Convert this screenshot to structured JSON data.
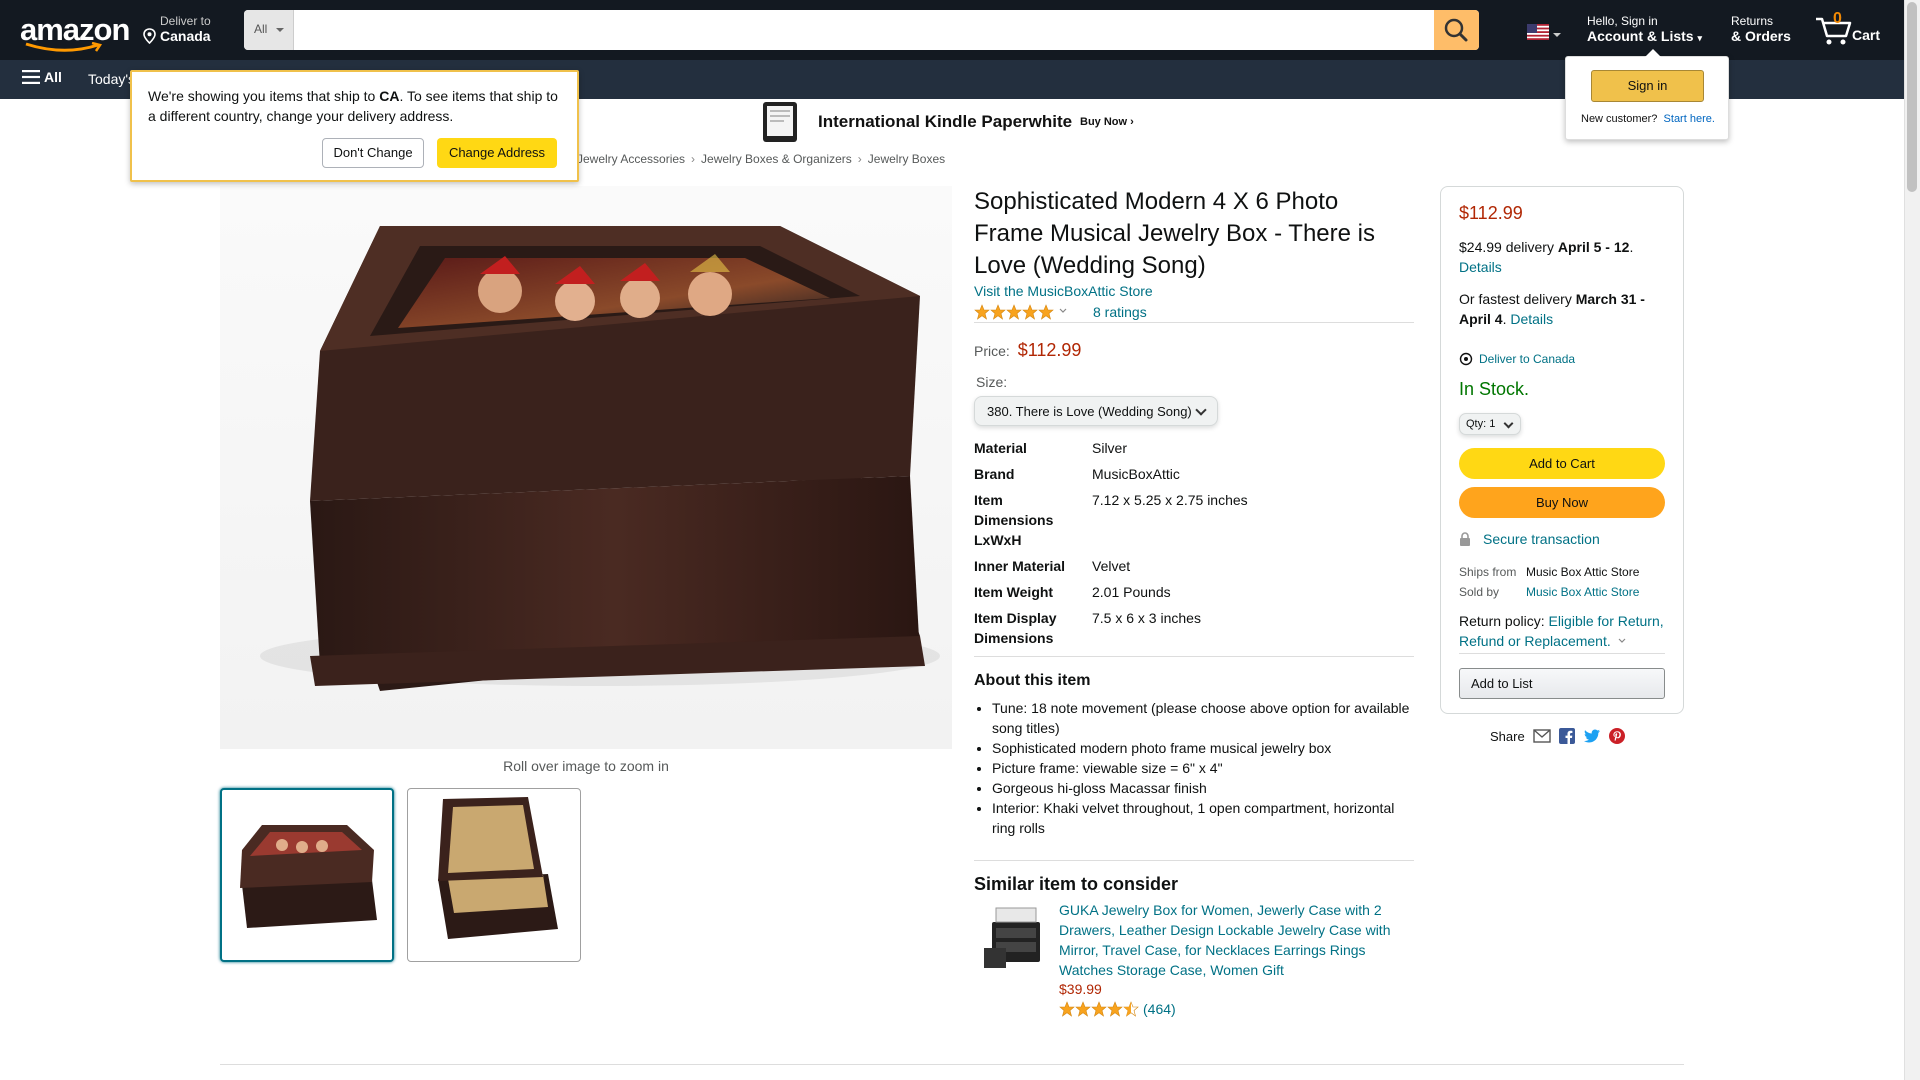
{
  "header": {
    "logo": "amazon",
    "deliver_line1": "Deliver to",
    "deliver_line2": "Canada",
    "search_category": "All",
    "search_placeholder": "",
    "account_line1": "Hello, Sign in",
    "account_line2": "Account & Lists",
    "returns_line1": "Returns",
    "returns_line2": "& Orders",
    "cart_count": "0",
    "cart_label": "Cart"
  },
  "nav": {
    "all_label": "All",
    "todays": "Today's"
  },
  "banner": {
    "title": "International Kindle Paperwhite",
    "cta": "Buy Now ›"
  },
  "breadcrumb": [
    "Jewelry Accessories",
    "Jewelry Boxes & Organizers",
    "Jewelry Boxes"
  ],
  "breadcrumb_sep": "›",
  "popover": {
    "text_a": "We're showing you items that ship to ",
    "text_country": "CA",
    "text_b": ". To see items that ship to a different country, change your delivery address.",
    "dont_change": "Don't Change",
    "change_address": "Change Address"
  },
  "flyout": {
    "sign_in": "Sign in",
    "new_customer": "New customer?",
    "start_here": "Start here."
  },
  "gallery": {
    "zoom_note": "Roll over image to zoom in"
  },
  "product": {
    "title": "Sophisticated Modern 4 X 6 Photo Frame Musical Jewelry Box - There is Love (Wedding Song)",
    "store_link": "Visit the MusicBoxAttic Store",
    "rating_stars": 5,
    "ratings_text": "8 ratings",
    "price_label": "Price:",
    "price": "$112.99",
    "size_label": "Size:",
    "size_value": "380. There is Love (Wedding Song)",
    "specs": [
      {
        "k": "Material",
        "v": "Silver"
      },
      {
        "k": "Brand",
        "v": "MusicBoxAttic"
      },
      {
        "k": "Item Dimensions LxWxH",
        "v": "7.12 x 5.25 x 2.75 inches"
      },
      {
        "k": "Inner Material",
        "v": "Velvet"
      },
      {
        "k": "Item Weight",
        "v": "2.01 Pounds"
      },
      {
        "k": "Item Display Dimensions",
        "v": "7.5 x 6 x 3 inches"
      }
    ],
    "about_heading": "About this item",
    "about": [
      "Tune: 18 note movement (please choose above option for available song titles)",
      "Sophisticated modern photo frame musical jewelry box",
      "Picture frame: viewable size = 6\" x 4\"",
      "Gorgeous hi-gloss Macassar finish",
      "Interior: Khaki velvet throughout, 1 open compartment, horizontal ring rolls"
    ]
  },
  "similar": {
    "heading": "Similar item to consider",
    "title": "GUKA Jewelry Box for Women, Jewerly Case with 2 Drawers, Leather Design Lockable Jewelry Case with Mirror, Travel Case, for Necklaces Earrings Rings Watches Storage Case, Women Gift",
    "price": "$39.99",
    "rating_stars": 4.5,
    "count": "(464)"
  },
  "buybox": {
    "price": "$112.99",
    "delivery_a": "$24.99 delivery ",
    "delivery_b": "April 5 - 12",
    "delivery_c": ".",
    "details": "Details",
    "fastest_a": "Or fastest delivery ",
    "fastest_b": "March 31 - April 4",
    "fastest_c": ". ",
    "deliver_to": "Deliver to Canada",
    "stock": "In Stock.",
    "qty_label": "Qty:",
    "qty_value": "1",
    "add_to_cart": "Add to Cart",
    "buy_now": "Buy Now",
    "secure": "Secure transaction",
    "ships_from_label": "Ships from",
    "ships_from": "Music Box Attic Store",
    "sold_by_label": "Sold by",
    "sold_by": "Music Box Attic Store",
    "return_label": "Return policy: ",
    "return_link": "Eligible for Return, Refund or Replacement.",
    "add_to_list": "Add to List"
  },
  "share": {
    "label": "Share"
  },
  "colors": {
    "header_bg": "#131921",
    "nav_bg": "#232f3e",
    "price": "#b12704",
    "link": "#007185",
    "in_stock": "#007600",
    "add_to_cart": "#ffd814",
    "buy_now": "#ffa41c"
  }
}
